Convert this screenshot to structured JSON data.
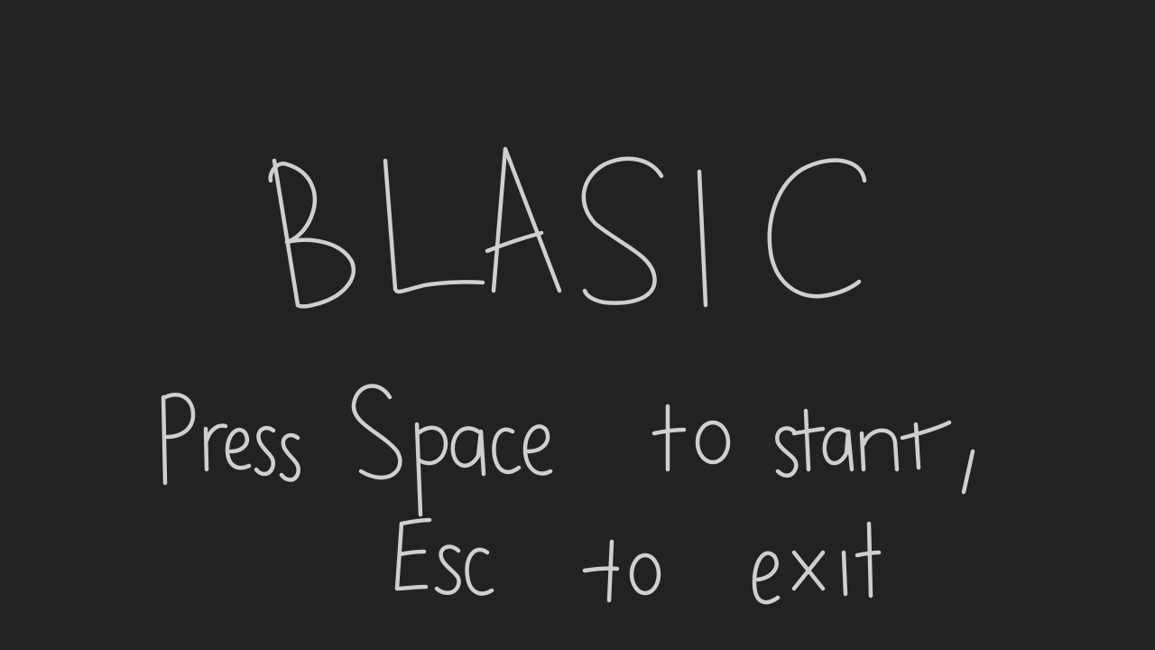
{
  "game": {
    "title": "BLASIC",
    "prompt_line_1": "Press Space to start,",
    "prompt_line_2": "Esc to exit"
  },
  "colors": {
    "background": "#222222",
    "ink": "#cfcfcf"
  }
}
